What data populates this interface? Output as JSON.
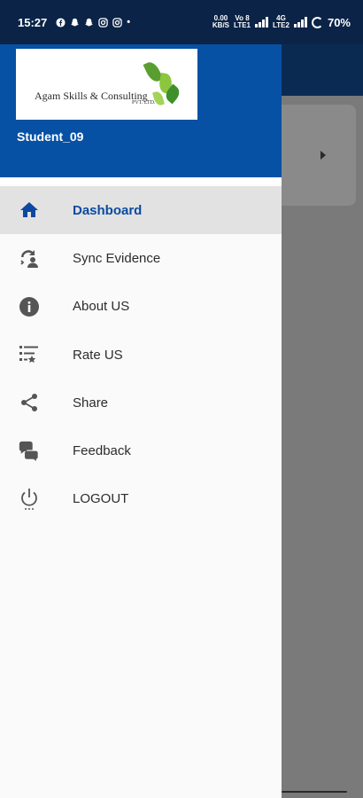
{
  "status_bar": {
    "time": "15:27",
    "app_icons": [
      "facebook-icon",
      "snapchat-icon",
      "snapchat-icon",
      "instagram-icon",
      "instagram-icon"
    ],
    "dot": "•",
    "speed_top": "0.00",
    "speed_bottom": "KB/S",
    "net1_top": "Vo 8",
    "net1_bottom": "LTE1",
    "net2_top": "4G",
    "net2_bottom": "LTE2",
    "battery": "70%"
  },
  "drawer": {
    "logo": {
      "company": "Agam Skills & Consulting",
      "suffix": "PVT. LTD."
    },
    "user_name": "Student_09",
    "menu": [
      {
        "label": "Dashboard",
        "icon": "home-icon",
        "active": true
      },
      {
        "label": "Sync Evidence",
        "icon": "sync-icon",
        "active": false
      },
      {
        "label": "About US",
        "icon": "info-icon",
        "active": false
      },
      {
        "label": "Rate US",
        "icon": "rate-list-icon",
        "active": false
      },
      {
        "label": "Share",
        "icon": "share-icon",
        "active": false
      },
      {
        "label": "Feedback",
        "icon": "feedback-icon",
        "active": false
      },
      {
        "label": "LOGOUT",
        "icon": "power-icon",
        "active": false
      }
    ]
  },
  "colors": {
    "drawer_header": "#0751a4",
    "status_bar": "#0a2347",
    "active_text": "#0b4aa0",
    "active_bg": "#e2e2e2"
  }
}
